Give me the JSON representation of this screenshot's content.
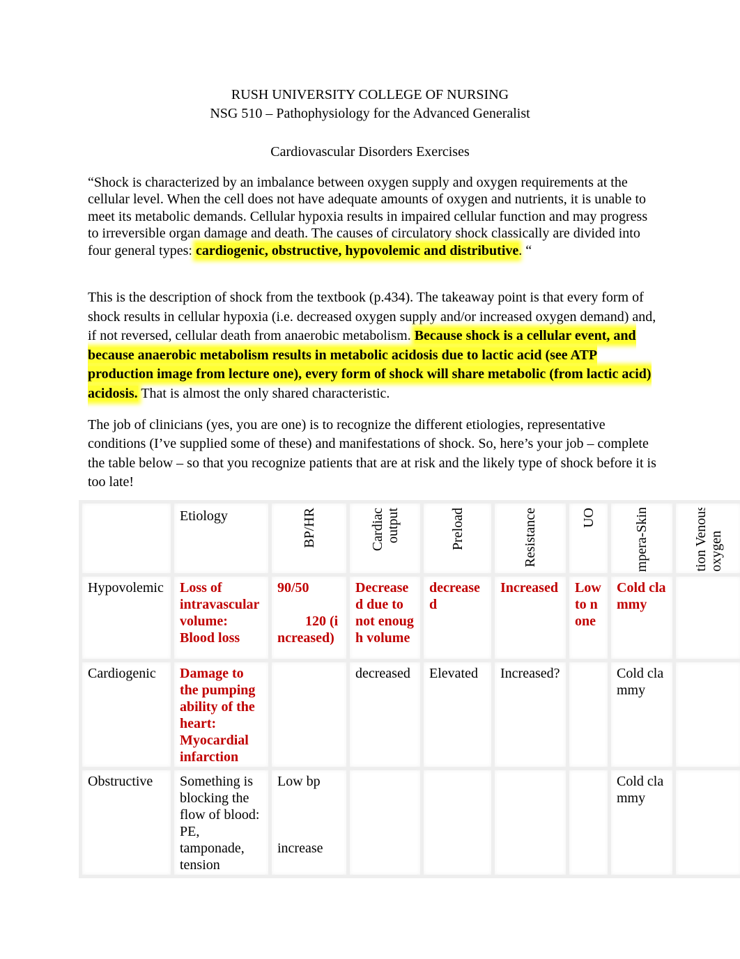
{
  "header": {
    "institution": "RUSH UNIVERSITY COLLEGE OF NURSING",
    "course": "NSG 510 – Pathophysiology for the Advanced Generalist",
    "title": "Cardiovascular Disorders Exercises"
  },
  "quote": {
    "text_before": "“Shock is characterized by an imbalance between oxygen supply and oxygen requirements at the cellular level. When the cell does not have adequate amounts of oxygen and nutrients, it is unable to meet its metabolic demands. Cellular hypoxia results in impaired cellular function and may progress to irreversible organ damage and death. The causes of circulatory shock classically are divided into four general types: ",
    "highlight": "cardiogenic, obstructive, hypovolemic and distributive",
    "text_after": ". “"
  },
  "takeaway": {
    "text_before": "This is the description of shock from the textbook (p.434).  The takeaway point is that every form of shock results in cellular hypoxia (i.e. decreased oxygen supply and/or increased oxygen demand) and, if not reversed, cellular death from anaerobic metabolism.  ",
    "highlight": "Because shock is a cellular event, and because anaerobic metabolism results in metabolic acidosis due to lactic acid (see ATP production image from lecture one), every form of shock will share metabolic (from lactic acid) acidosis.",
    "text_after": "  That is almost the only shared characteristic."
  },
  "instructions": {
    "text": "The job of clinicians (yes, you are one) is to recognize the different etiologies, representative conditions (I’ve supplied some of these) and manifestations of shock.   So, here’s your job – complete the table below – so that you recognize patients that are at risk and the likely type of shock before it is too late!"
  },
  "table": {
    "headers": {
      "type": "",
      "etiology": "Etiology",
      "bp_hr": "BP/HR",
      "cardiac_output_1": "Cardiac",
      "cardiac_output_2": "output",
      "preload": "Preload",
      "resistance": "Resistance",
      "uo": "UO",
      "temp_skin": "mpera-Skin",
      "venous_1": "tion Venous",
      "venous_2": "oxygen"
    },
    "rows": {
      "hypovolemic": {
        "type": "Hypovolemic",
        "etiology": "Loss of intravascular volume: Blood loss",
        "bp": "90/50",
        "hr": "120 (increased)",
        "cardiac_output": "Decreased due to not enough volume",
        "preload": "decreased",
        "resistance": "Increased",
        "uo": "Low to none",
        "temp_skin": "Cold clammy",
        "venous_oxygen": ""
      },
      "cardiogenic": {
        "type": "Cardiogenic",
        "etiology": "Damage to the pumping ability of the heart: Myocardial infarction",
        "bp_hr": "",
        "cardiac_output": "decreased",
        "preload": "Elevated",
        "resistance": "Increased?",
        "uo": "",
        "temp_skin": "Cold clammy",
        "venous_oxygen": ""
      },
      "obstructive": {
        "type": "Obstructive",
        "etiology": "Something is blocking the flow of blood: PE, tamponade, tension",
        "bp": "Low bp",
        "hr": "increase",
        "cardiac_output": "",
        "preload": "",
        "resistance": "",
        "uo": "",
        "temp_skin": "Cold clammy",
        "venous_oxygen": ""
      }
    }
  },
  "colors": {
    "highlight": "#ffff33",
    "answer_red": "#c00000",
    "table_border": "#eeeeee"
  }
}
